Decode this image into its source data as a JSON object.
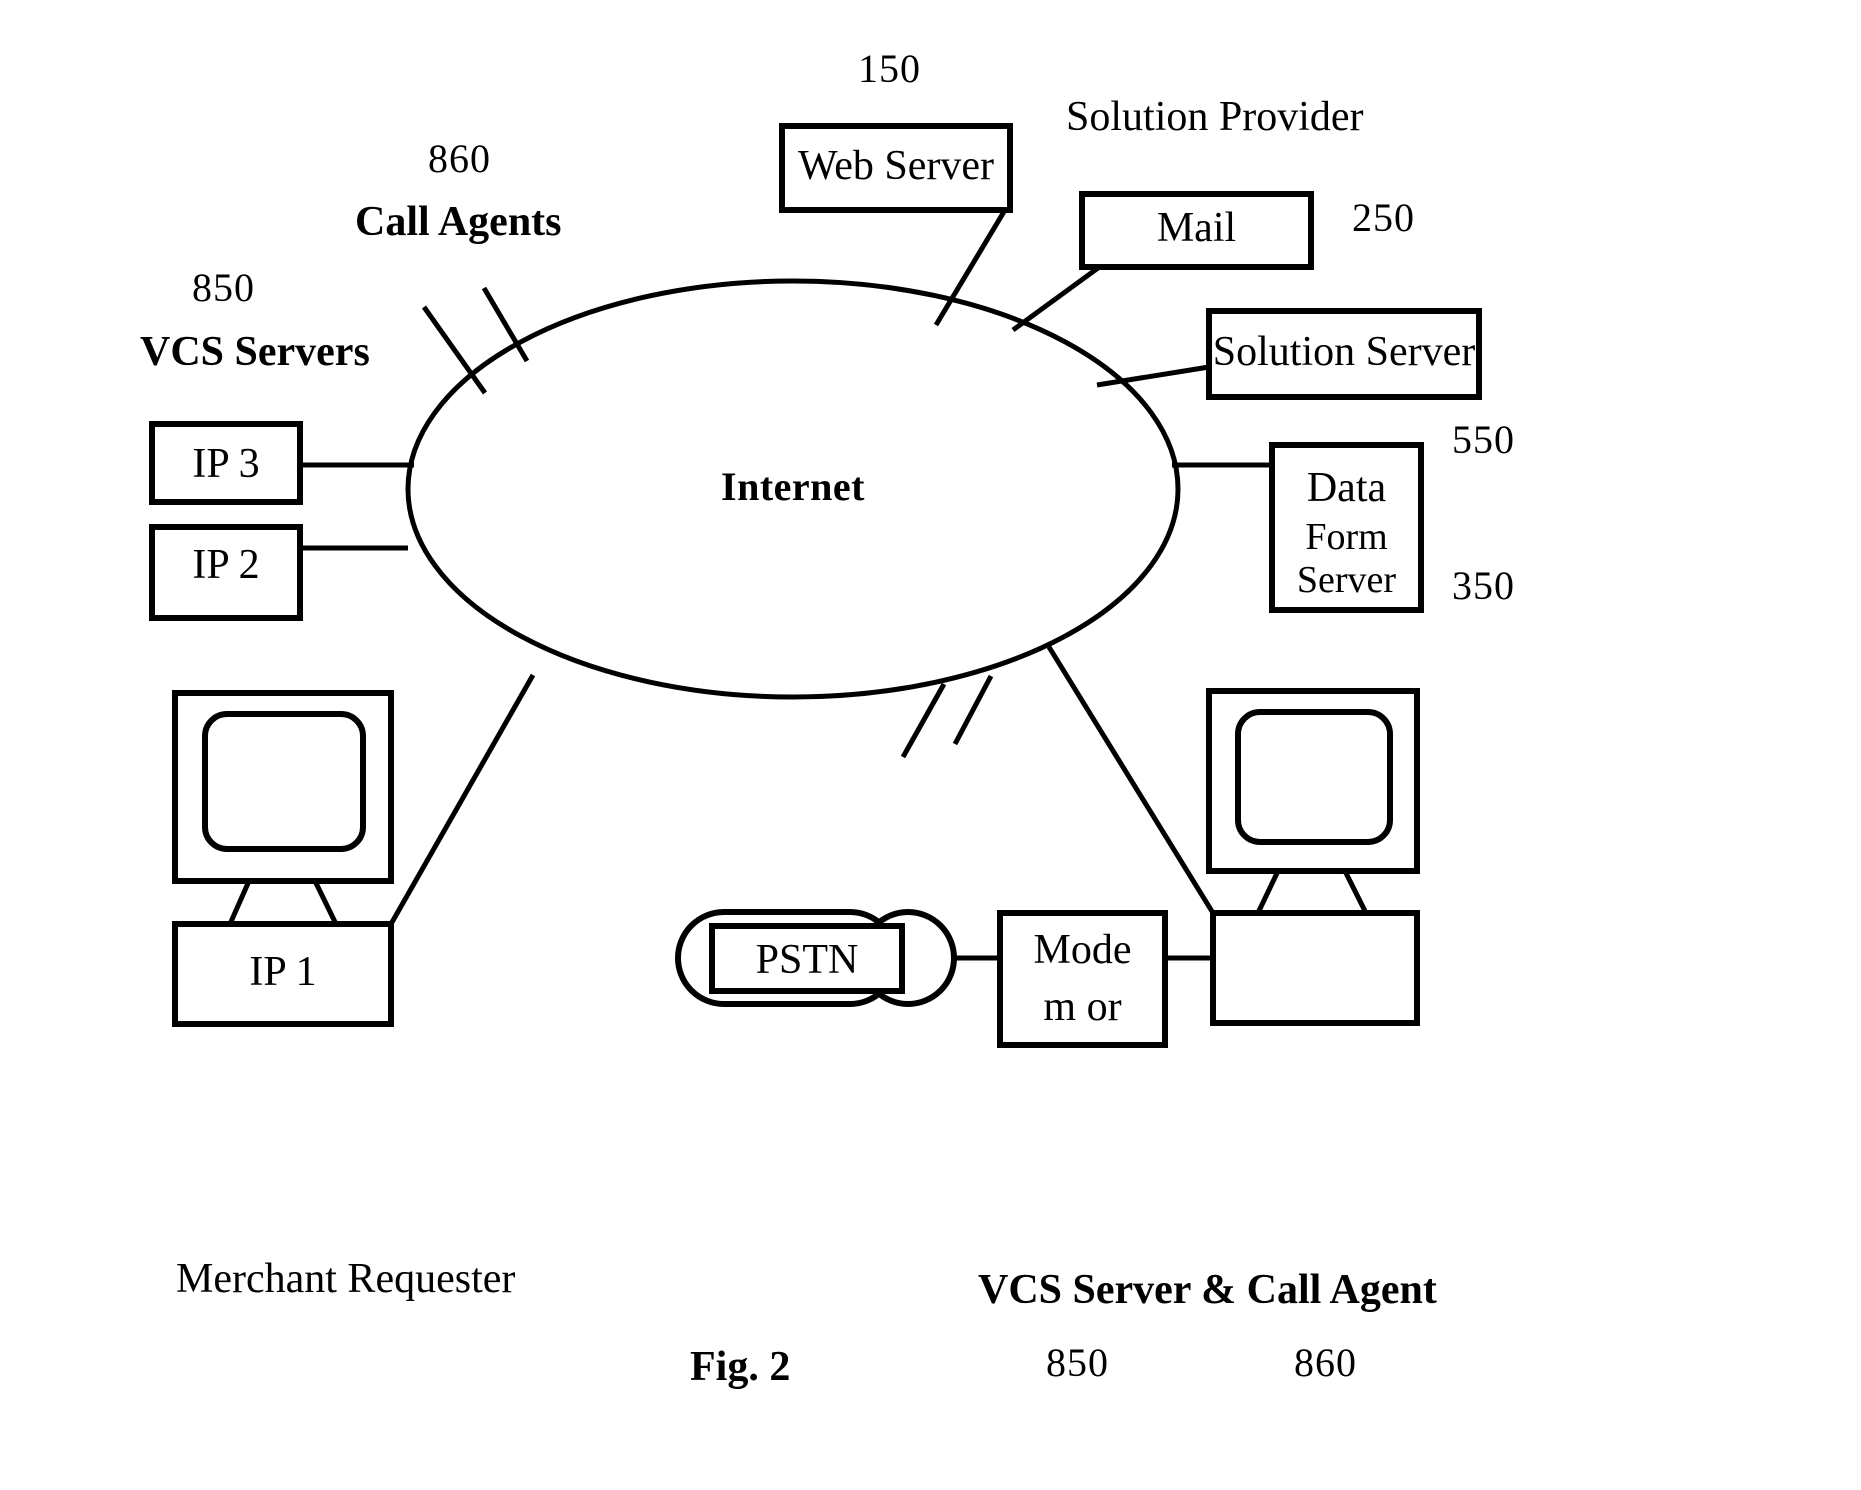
{
  "figure": {
    "caption": "Fig. 2",
    "network_cloud_label": "Internet"
  },
  "groups": {
    "vcs_servers": {
      "ref": "850",
      "label": "VCS Servers"
    },
    "call_agents": {
      "ref": "860",
      "label": "Call Agents"
    },
    "solution_provider": {
      "label": "Solution Provider"
    },
    "merchant_requester": {
      "label": "Merchant Requester"
    },
    "vcs_server_call_agent": {
      "label": "VCS Server & Call Agent",
      "ref_left": "850",
      "ref_right": "860"
    }
  },
  "nodes": {
    "web_server": {
      "label": "Web Server",
      "ref": "150"
    },
    "mail": {
      "label": "Mail",
      "ref": "250"
    },
    "solution_server": {
      "label": "Solution Server",
      "ref": "550"
    },
    "data_form_server": {
      "line1": "Data",
      "line2": "Form",
      "line3": "Server",
      "ref": "350"
    },
    "ip3": {
      "label": "IP 3"
    },
    "ip2": {
      "label": "IP 2"
    },
    "ip1": {
      "label": "IP 1"
    },
    "pstn": {
      "label": "PSTN"
    },
    "modem": {
      "line1": "Mode",
      "line2": "m or"
    }
  },
  "colors": {
    "stroke": "#000000",
    "background": "#ffffff"
  }
}
